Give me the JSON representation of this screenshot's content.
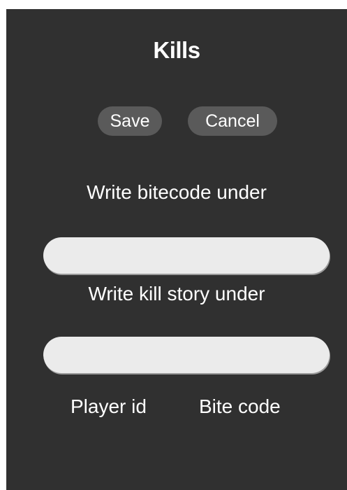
{
  "panel": {
    "title": "Kills"
  },
  "actions": {
    "save_label": "Save",
    "cancel_label": "Cancel"
  },
  "form": {
    "bitecode_label": "Write bitecode under",
    "bitecode_value": "",
    "bitecode_placeholder": "",
    "story_label": "Write kill story under",
    "story_value": "",
    "story_placeholder": ""
  },
  "footer": {
    "player_id_label": "Player id",
    "bite_code_label": "Bite code"
  },
  "colors": {
    "panel_background": "#303030",
    "button_background": "#5a5a5a",
    "input_background": "#ebebeb",
    "text": "#ffffff"
  }
}
